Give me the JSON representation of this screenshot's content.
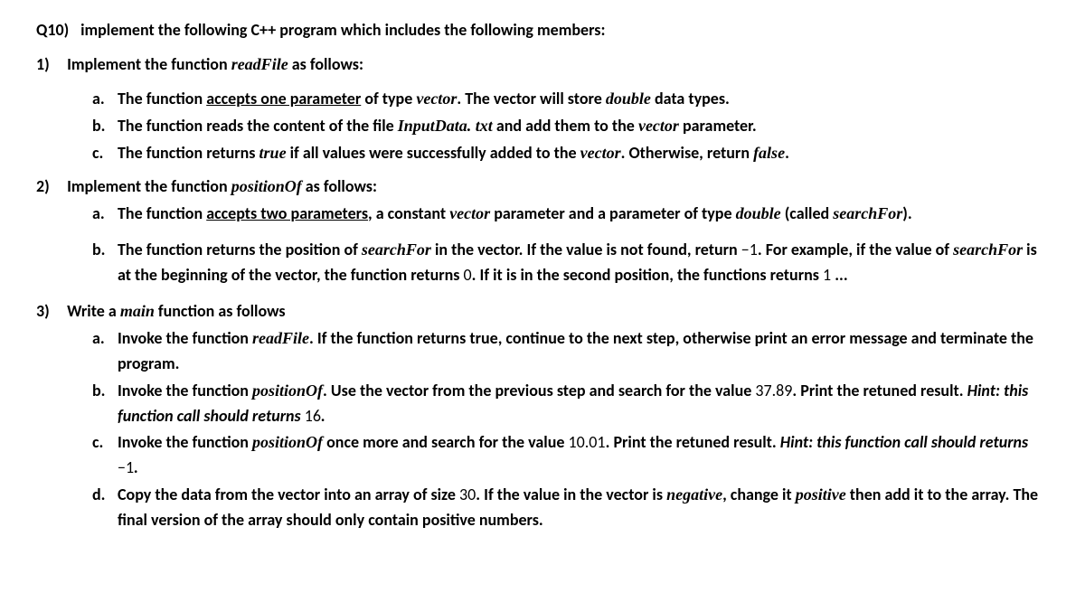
{
  "q": {
    "label": "Q10)",
    "text_a": "implement the following C++ program which includes the following members:"
  },
  "p1": {
    "label": "1)",
    "text_a": "Implement the function ",
    "var_a": "readFile",
    "text_b": " as follows:",
    "a": {
      "label": "a.",
      "t1": "The function ",
      "u1": "accepts one parameter",
      "t2": " of type ",
      "v1": "vector",
      "t3": ". The vector will store ",
      "v2": "double",
      "t4": " data types."
    },
    "b": {
      "label": "b.",
      "t1": "The function reads the content of the file ",
      "v1": "InputData. txt",
      "t2": " and add them to the ",
      "v2": "vector",
      "t3": " parameter."
    },
    "c": {
      "label": "c.",
      "t1": "The function returns ",
      "v1": "true",
      "t2": " if all values were successfully added to the ",
      "v2": "vector",
      "t3": ". Otherwise, return ",
      "v3": "false",
      "t4": "."
    }
  },
  "p2": {
    "label": "2)",
    "text_a": "Implement the function ",
    "var_a": "positionOf",
    "text_b": " as follows:",
    "a": {
      "label": "a.",
      "t1": "The function ",
      "u1": "accepts two parameters",
      "t2": ", a constant ",
      "v1": "vector",
      "t3": " parameter and a parameter of type ",
      "v2": "double",
      "t4": " (called ",
      "v3": "searchFor",
      "t5": ")."
    },
    "b": {
      "label": "b.",
      "t1": "The function returns the position of ",
      "v1": "searchFor",
      "t2": " in the vector. If the value is not found, return ",
      "n1": "−1",
      "t3": ". For example, if the value of ",
      "v2": "searchFor",
      "t4": " is at the beginning of the vector, the function returns ",
      "n2": "0",
      "t5": ". If it is in the second position, the functions returns ",
      "n3": "1",
      "t6": " ..."
    }
  },
  "p3": {
    "label": "3)",
    "text_a": "Write a ",
    "var_a": "main",
    "text_b": " function as follows",
    "a": {
      "label": "a.",
      "t1": "Invoke the function ",
      "v1": "readFile",
      "t2": ". If the function returns true, continue to the next step, otherwise print an error message and terminate the program."
    },
    "b": {
      "label": "b.",
      "t1": "Invoke the function ",
      "v1": "positionOf",
      "t2": ". Use the vector from the previous step and search for the value ",
      "n1": "37.89",
      "t3": ". Print the retuned result. ",
      "h1": "Hint: this function call should returns ",
      "n2": "16",
      "t4": "."
    },
    "c": {
      "label": "c.",
      "t1": "Invoke the function ",
      "v1": "positionOf",
      "t2": " once more and search for the value ",
      "n1": "10.01",
      "t3": ". Print the retuned result. ",
      "h1": "Hint: this function call should returns ",
      "n2": "−1",
      "t4": "."
    },
    "d": {
      "label": "d.",
      "t1": "Copy the data from the vector into an array of size ",
      "n1": "30",
      "t2": ". If the value in the vector is ",
      "v1": "negative",
      "t3": ", change it ",
      "v2": "positive",
      "t4": " then add it to the array. The final version of the array should only contain positive numbers."
    }
  }
}
